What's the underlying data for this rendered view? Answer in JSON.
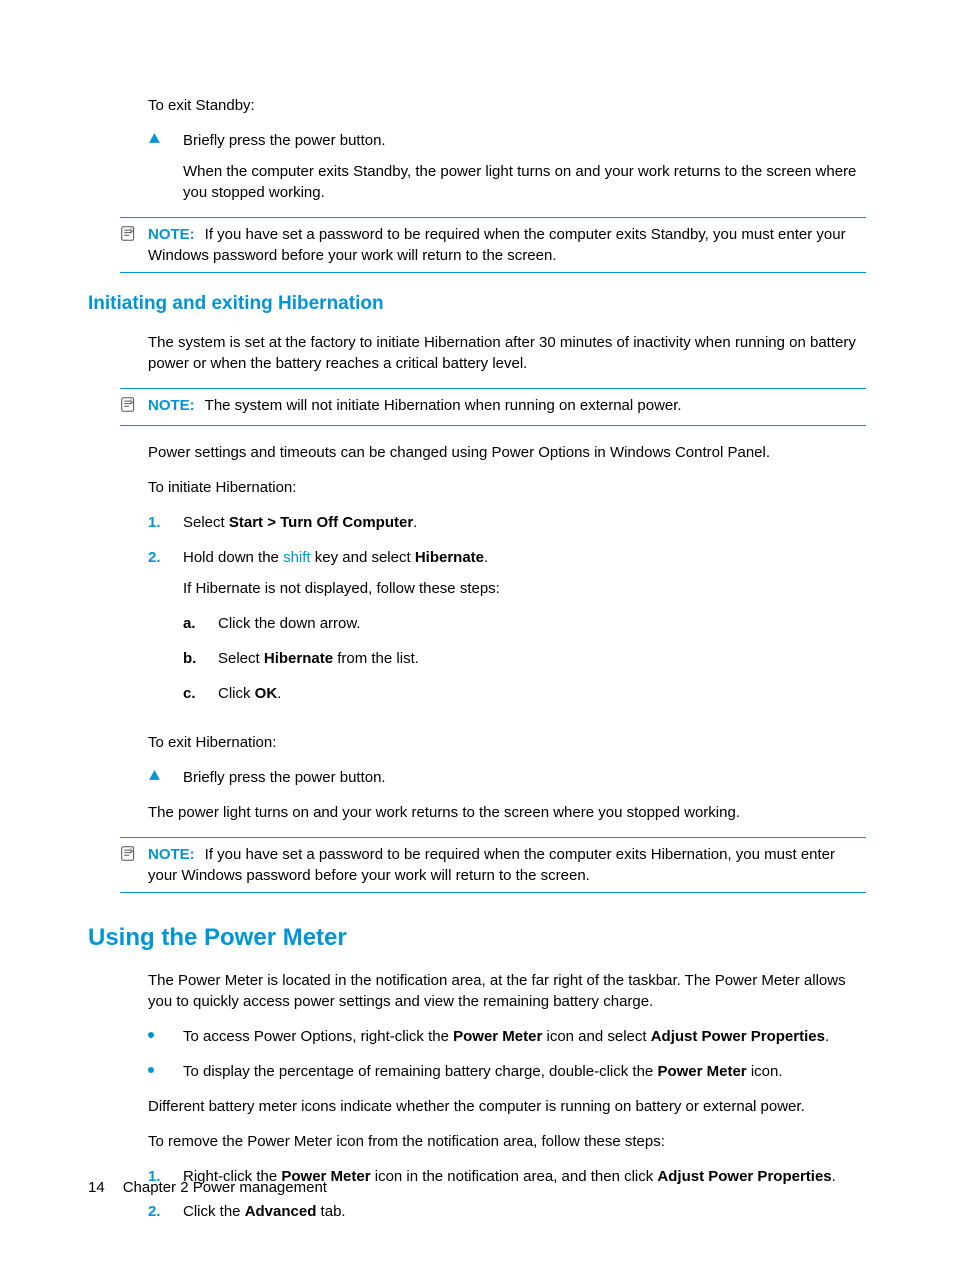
{
  "intro": {
    "exit_standby": "To exit Standby:",
    "briefly_press": "Briefly press the power button.",
    "when_exits": "When the computer exits Standby, the power light turns on and your work returns to the screen where you stopped working."
  },
  "note1": {
    "label": "NOTE:",
    "text": "If you have set a password to be required when the computer exits Standby, you must enter your Windows password before your work will return to the screen."
  },
  "section_hibernation": {
    "heading": "Initiating and exiting Hibernation",
    "system_set": "The system is set at the factory to initiate Hibernation after 30 minutes of inactivity when running on battery power or when the battery reaches a critical battery level.",
    "note2_label": "NOTE:",
    "note2_text": "The system will not initiate Hibernation when running on external power.",
    "power_settings": "Power settings and timeouts can be changed using Power Options in Windows Control Panel.",
    "to_initiate": "To initiate Hibernation:",
    "step1_num": "1.",
    "step1_pre": "Select ",
    "step1_bold": "Start > Turn Off Computer",
    "step1_suf": ".",
    "step2_num": "2.",
    "step2_pre": "Hold down the ",
    "step2_shift": "shift",
    "step2_mid": " key and select ",
    "step2_bold": "Hibernate",
    "step2_suf": ".",
    "if_not_displayed": "If Hibernate is not displayed, follow these steps:",
    "sub_a": "a.",
    "sub_a_text": "Click the down arrow.",
    "sub_b": "b.",
    "sub_b_pre": "Select ",
    "sub_b_bold": "Hibernate",
    "sub_b_suf": " from the list.",
    "sub_c": "c.",
    "sub_c_pre": "Click ",
    "sub_c_bold": "OK",
    "sub_c_suf": ".",
    "to_exit": "To exit Hibernation:",
    "exit_bullet": "Briefly press the power button.",
    "power_light": "The power light turns on and your work returns to the screen where you stopped working.",
    "note3_label": "NOTE:",
    "note3_text": "If you have set a password to be required when the computer exits Hibernation, you must enter your Windows password before your work will return to the screen."
  },
  "section_power_meter": {
    "heading": "Using the Power Meter",
    "intro": "The Power Meter is located in the notification area, at the far right of the taskbar. The Power Meter allows you to quickly access power settings and view the remaining battery charge.",
    "bullet1_pre": "To access Power Options, right-click the ",
    "bullet1_b1": "Power Meter",
    "bullet1_mid": " icon and select ",
    "bullet1_b2": "Adjust Power Properties",
    "bullet1_suf": ".",
    "bullet2_pre": "To display the percentage of remaining battery charge, double-click the ",
    "bullet2_b1": "Power Meter",
    "bullet2_suf": " icon.",
    "diff_icons": "Different battery meter icons indicate whether the computer is running on battery or external power.",
    "to_remove": "To remove the Power Meter icon from the notification area, follow these steps:",
    "pm_step1_num": "1.",
    "pm_step1_pre": "Right-click the ",
    "pm_step1_b1": "Power Meter",
    "pm_step1_mid": " icon in the notification area, and then click ",
    "pm_step1_b2": "Adjust Power Properties",
    "pm_step1_suf": ".",
    "pm_step2_num": "2.",
    "pm_step2_pre": "Click the ",
    "pm_step2_b1": "Advanced",
    "pm_step2_suf": " tab."
  },
  "footer": {
    "page": "14",
    "chapter": "Chapter 2   Power management"
  }
}
